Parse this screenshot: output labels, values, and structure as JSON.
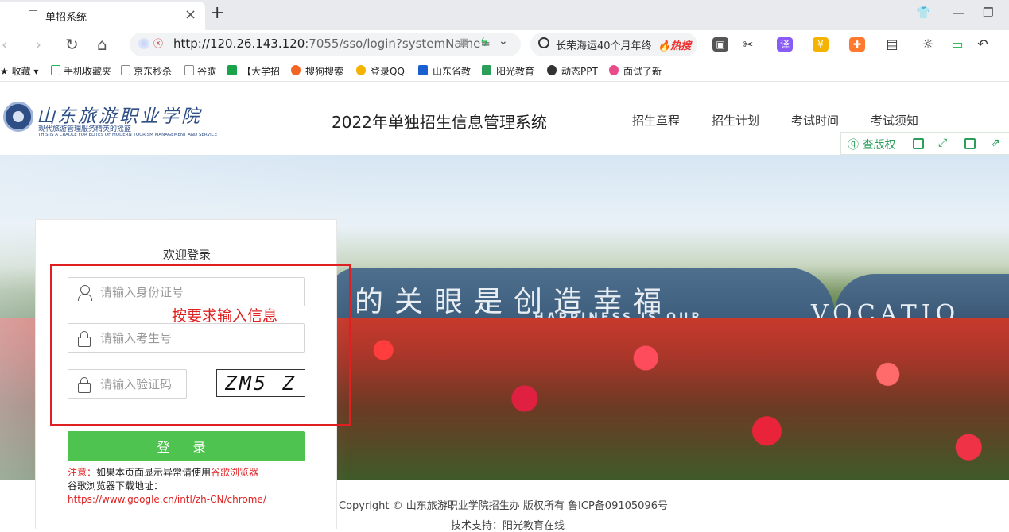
{
  "browser": {
    "tab_title": "单招系统",
    "url_host": "http://120.26.143.120",
    "url_rest": ":7055/sso/login?systemName=",
    "search_query": "长荣海运40个月年终",
    "search_hot": "🔥热搜",
    "ext_translate": "译",
    "bookmarks": [
      "收藏",
      "手机收藏夹",
      "京东秒杀",
      "谷歌",
      "【大学招",
      "搜狗搜索",
      "登录QQ",
      "山东省教",
      "阳光教育",
      "动态PPT",
      "面试了新"
    ]
  },
  "header": {
    "logo_text": "山东旅游职业学院",
    "logo_sub": "现代旅游管理服务精英的摇篮",
    "logo_sub_en": "THIS IS A CRADLE FOR ELITES OF MODERN TOURISM MANAGEMENT AND SERVICE",
    "system_title": "2022年单独招生信息管理系统",
    "menu": [
      "招生章程",
      "招生计划",
      "考试时间",
      "考试须知"
    ],
    "toolstrip_label": "查版权"
  },
  "hero": {
    "carving": "的关眼是创造幸福",
    "carving_en": "HAPPINESS IS OUR",
    "carving_en2": "VOCATIO"
  },
  "login": {
    "welcome": "欢迎登录",
    "id_placeholder": "请输入身份证号",
    "exam_placeholder": "请输入考生号",
    "captcha_placeholder": "请输入验证码",
    "captcha_text": "ZM5 Z",
    "login_label": "登 录",
    "note_prefix": "注意：",
    "note_text": "如果本页面显示异常请使用",
    "note_browser": "谷歌浏览器",
    "download_label": "谷歌浏览器下载地址：",
    "download_url": "https://www.google.cn/intl/zh-CN/chrome/"
  },
  "annotation": {
    "text": "按要求输入信息",
    "color": "#e02020"
  },
  "footer": {
    "copyright": "Copyright © 山东旅游职业学院招生办 版权所有 鲁ICP备09105096号",
    "support": "技术支持：阳光教育在线"
  }
}
